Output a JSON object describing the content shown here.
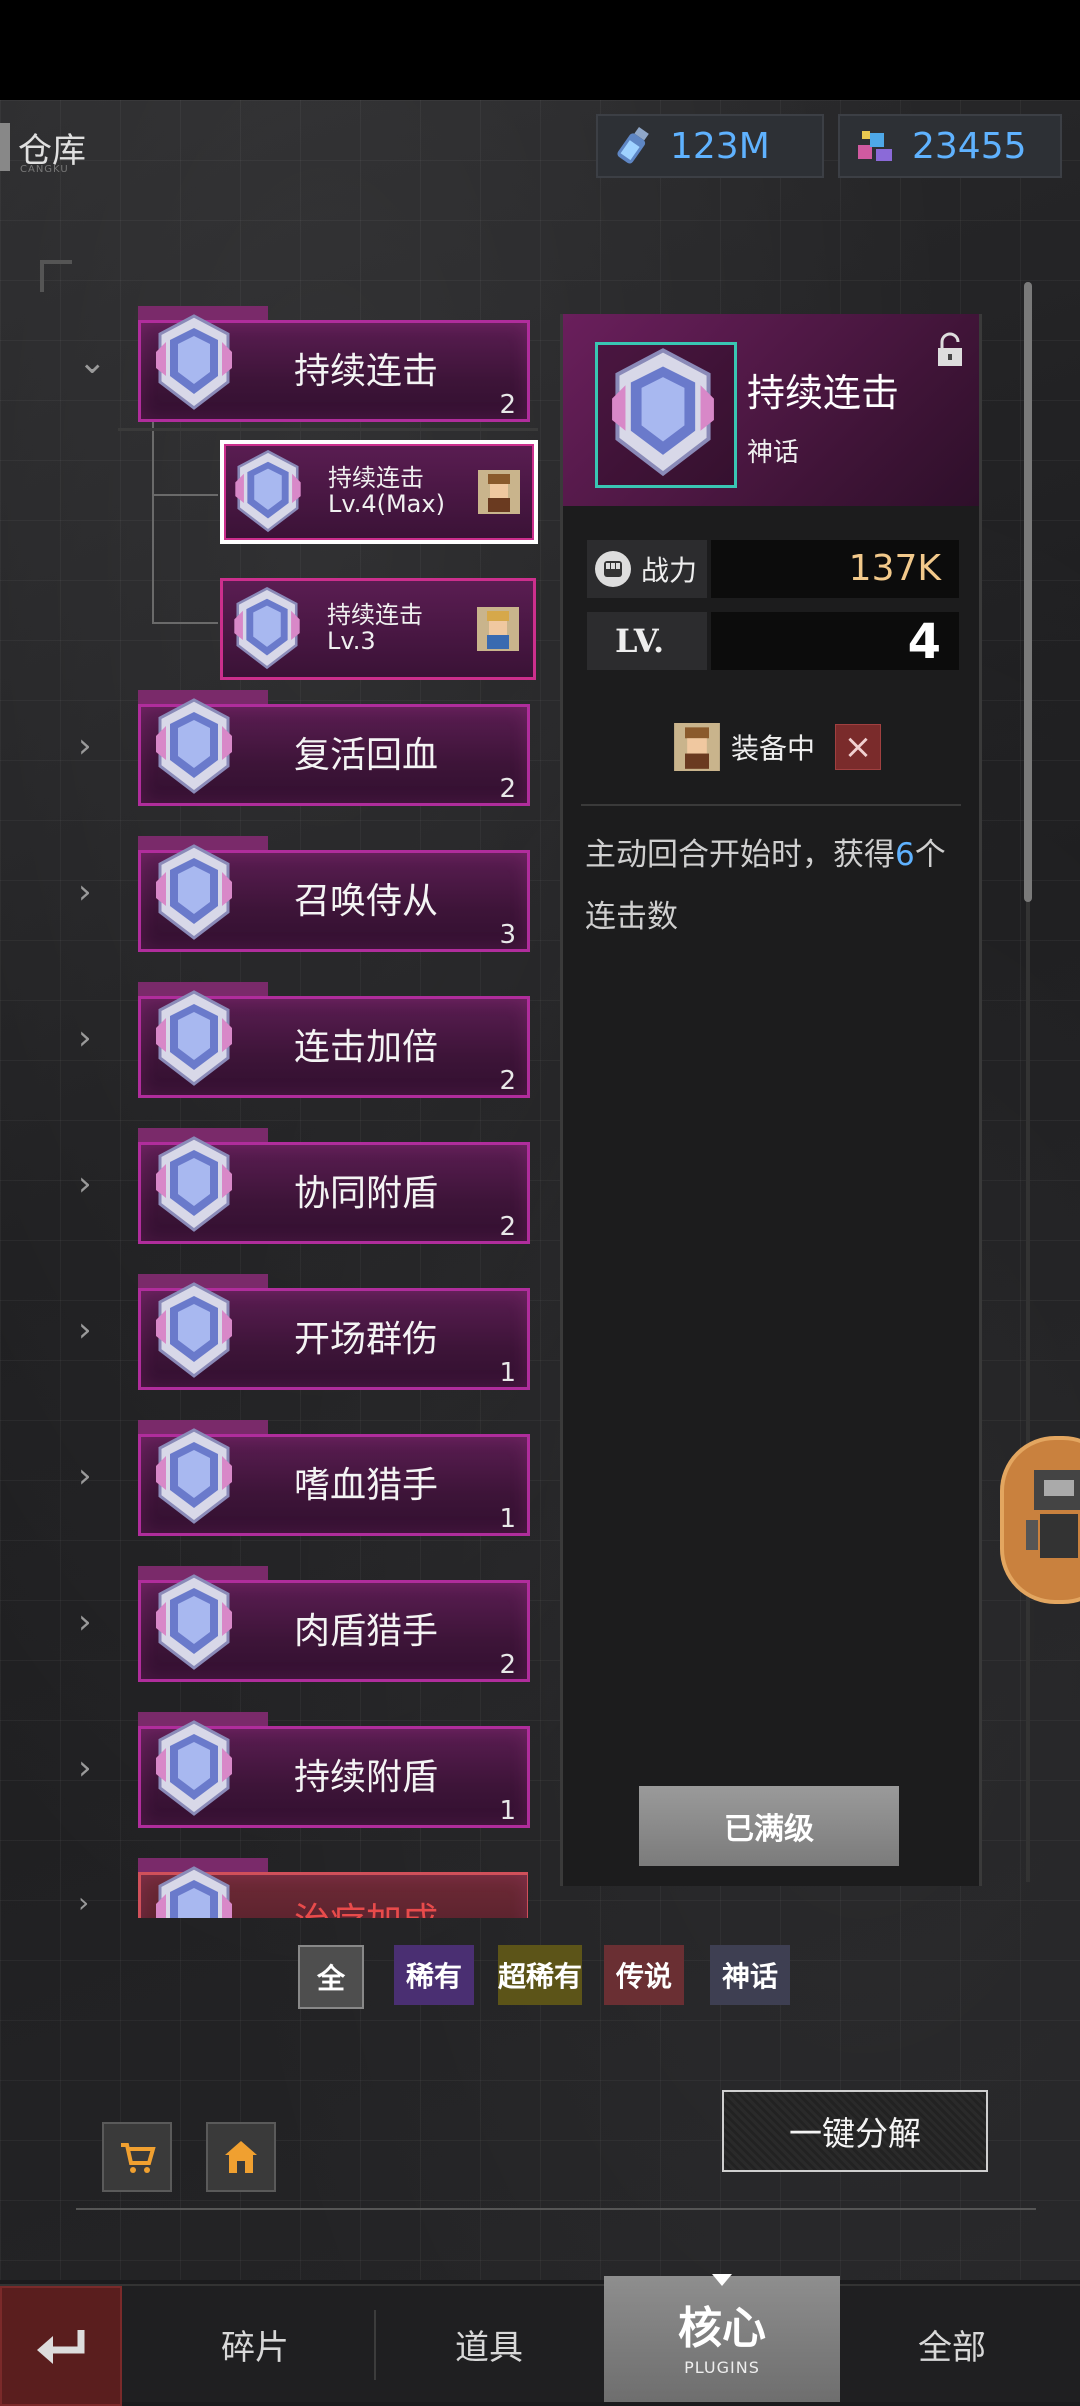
{
  "header": {
    "title": "仓库",
    "subtitle": "CANGKU"
  },
  "currency": {
    "energy": "123M",
    "gems": "23455"
  },
  "core_list": [
    {
      "name": "持续连击",
      "count": "2",
      "expanded": true
    },
    {
      "name": "复活回血",
      "count": "2"
    },
    {
      "name": "召唤侍从",
      "count": "3"
    },
    {
      "name": "连击加倍",
      "count": "2"
    },
    {
      "name": "协同附盾",
      "count": "2"
    },
    {
      "name": "开场群伤",
      "count": "1"
    },
    {
      "name": "嗜血猎手",
      "count": "1"
    },
    {
      "name": "肉盾猎手",
      "count": "2"
    },
    {
      "name": "持续附盾",
      "count": "1"
    },
    {
      "name": "治疗加成",
      "count": ""
    }
  ],
  "sub_items": [
    {
      "name": "持续连击",
      "level": "Lv.4(Max)",
      "selected": true
    },
    {
      "name": "持续连击",
      "level": "Lv.3",
      "selected": false
    }
  ],
  "detail": {
    "name": "持续连击",
    "rarity": "神话",
    "power_label": "战力",
    "power_value": "137K",
    "level_label": "LV.",
    "level_value": "4",
    "equipped_label": "装备中",
    "desc_part1": "主动回合开始时，获得",
    "desc_highlight": "6",
    "desc_part2": "个连击数",
    "max_button": "已满级"
  },
  "filters": {
    "all": "全",
    "rare": "稀有",
    "super_rare": "超稀有",
    "legendary": "传说",
    "mythic": "神话",
    "colors": {
      "all": "#4e4e4e",
      "rare": "#4a2f72",
      "super_rare": "#5c5418",
      "legendary": "#6a2f33",
      "mythic": "#3e3f52"
    }
  },
  "actions": {
    "decompose": "一键分解"
  },
  "nav": {
    "fragments": "碎片",
    "items": "道具",
    "core": "核心",
    "core_sub": "PLUGINS",
    "all": "全部"
  },
  "colors": {
    "accent_magenta": "#b02d9c",
    "highlight_blue": "#5fb2ff",
    "power_gold": "#f2c98b"
  }
}
